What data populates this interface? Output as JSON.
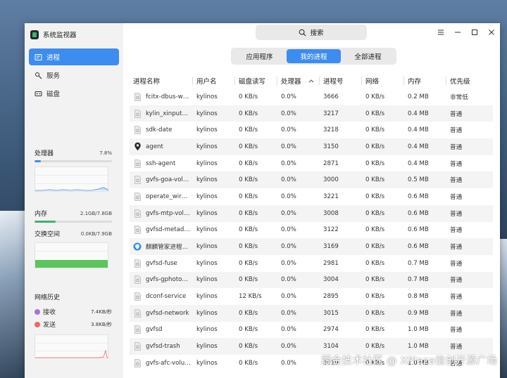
{
  "app": {
    "title": "系统监视器"
  },
  "sidebar": {
    "items": [
      {
        "label": "进程",
        "icon": "process-icon",
        "active": true
      },
      {
        "label": "服务",
        "icon": "service-icon",
        "active": false
      },
      {
        "label": "磁盘",
        "icon": "disk-icon",
        "active": false
      }
    ],
    "cpu": {
      "label": "处理器",
      "value": "7.8%",
      "percent": 7.8
    },
    "memory": {
      "label": "内存",
      "value": "2.1GB/7.8GB",
      "percent": 27
    },
    "swap": {
      "label": "交换空间",
      "value": "0.0KB/7.9GB",
      "percent": 0
    },
    "network": {
      "label": "网络历史",
      "recv_label": "接收",
      "recv_value": "7.4KB/秒",
      "recv_color": "#a675d8",
      "send_label": "发送",
      "send_value": "3.8KB/秒",
      "send_color": "#e86a6a"
    }
  },
  "search": {
    "label": "搜索"
  },
  "window_controls": {
    "menu": "☰",
    "minimize": "—",
    "maximize": "▢",
    "close": "✕"
  },
  "tabs": [
    {
      "label": "应用程序",
      "active": false
    },
    {
      "label": "我的进程",
      "active": true
    },
    {
      "label": "全部进程",
      "active": false
    }
  ],
  "columns": [
    "进程名称",
    "用户名",
    "磁盘读写",
    "处理器",
    "进程号",
    "网络",
    "内存",
    "优先级"
  ],
  "rows": [
    {
      "name": "fcitx-dbus-w…",
      "user": "kylinos",
      "disk": "0 KB/s",
      "cpu": "0.0%",
      "pid": "3666",
      "net": "0 KB/s",
      "mem": "0.2 MB",
      "prio": "非常低",
      "icon": "generic"
    },
    {
      "name": "kylin_xinput…",
      "user": "kylinos",
      "disk": "0 KB/s",
      "cpu": "0.0%",
      "pid": "3217",
      "net": "0 KB/s",
      "mem": "0.4 MB",
      "prio": "普通",
      "icon": "generic"
    },
    {
      "name": "sdk-date",
      "user": "kylinos",
      "disk": "0 KB/s",
      "cpu": "0.0%",
      "pid": "3218",
      "net": "0 KB/s",
      "mem": "0.4 MB",
      "prio": "普通",
      "icon": "generic"
    },
    {
      "name": "agent",
      "user": "kylinos",
      "disk": "0 KB/s",
      "cpu": "0.0%",
      "pid": "3150",
      "net": "0 KB/s",
      "mem": "0.4 MB",
      "prio": "普通",
      "icon": "pin"
    },
    {
      "name": "ssh-agent",
      "user": "kylinos",
      "disk": "0 KB/s",
      "cpu": "0.0%",
      "pid": "2871",
      "net": "0 KB/s",
      "mem": "0.4 MB",
      "prio": "普通",
      "icon": "generic"
    },
    {
      "name": "gvfs-goa-vol…",
      "user": "kylinos",
      "disk": "0 KB/s",
      "cpu": "0.0%",
      "pid": "3000",
      "net": "0 KB/s",
      "mem": "0.5 MB",
      "prio": "普通",
      "icon": "generic"
    },
    {
      "name": "operate_wir…",
      "user": "kylinos",
      "disk": "0 KB/s",
      "cpu": "0.0%",
      "pid": "3221",
      "net": "0 KB/s",
      "mem": "0.6 MB",
      "prio": "普通",
      "icon": "generic"
    },
    {
      "name": "gvfs-mtp-vol…",
      "user": "kylinos",
      "disk": "0 KB/s",
      "cpu": "0.0%",
      "pid": "3008",
      "net": "0 KB/s",
      "mem": "0.6 MB",
      "prio": "普通",
      "icon": "generic"
    },
    {
      "name": "gvfsd-metad…",
      "user": "kylinos",
      "disk": "0 KB/s",
      "cpu": "0.0%",
      "pid": "3122",
      "net": "0 KB/s",
      "mem": "0.6 MB",
      "prio": "普通",
      "icon": "generic"
    },
    {
      "name": "麒麟管家进程…",
      "user": "kylinos",
      "disk": "0 KB/s",
      "cpu": "0.0%",
      "pid": "3169",
      "net": "0 KB/s",
      "mem": "0.6 MB",
      "prio": "普通",
      "icon": "shield"
    },
    {
      "name": "gvfsd-fuse",
      "user": "kylinos",
      "disk": "0 KB/s",
      "cpu": "0.0%",
      "pid": "2981",
      "net": "0 KB/s",
      "mem": "0.7 MB",
      "prio": "普通",
      "icon": "generic"
    },
    {
      "name": "gvfs-gphoto…",
      "user": "kylinos",
      "disk": "0 KB/s",
      "cpu": "0.0%",
      "pid": "3004",
      "net": "0 KB/s",
      "mem": "0.7 MB",
      "prio": "普通",
      "icon": "generic"
    },
    {
      "name": "dconf-service",
      "user": "kylinos",
      "disk": "12 KB/s",
      "cpu": "0.0%",
      "pid": "2895",
      "net": "0 KB/s",
      "mem": "0.8 MB",
      "prio": "普通",
      "icon": "generic"
    },
    {
      "name": "gvfsd-network",
      "user": "kylinos",
      "disk": "0 KB/s",
      "cpu": "0.0%",
      "pid": "3015",
      "net": "0 KB/s",
      "mem": "0.9 MB",
      "prio": "普通",
      "icon": "generic"
    },
    {
      "name": "gvfsd",
      "user": "kylinos",
      "disk": "0 KB/s",
      "cpu": "0.0%",
      "pid": "2974",
      "net": "0 KB/s",
      "mem": "1.0 MB",
      "prio": "普通",
      "icon": "generic"
    },
    {
      "name": "gvfsd-trash",
      "user": "kylinos",
      "disk": "0 KB/s",
      "cpu": "0.0%",
      "pid": "3104",
      "net": "0 KB/s",
      "mem": "1.0 MB",
      "prio": "普通",
      "icon": "generic"
    },
    {
      "name": "gvfs-afc-volu…",
      "user": "kylinos",
      "disk": "0 KB/s",
      "cpu": "0.0%",
      "pid": "3019",
      "net": "0 KB/s",
      "mem": "1.0 MB",
      "prio": "普通",
      "icon": "generic"
    }
  ],
  "watermark": "掘金技术社区 @ XPlaza信创开源广场",
  "colors": {
    "accent": "#3d8cf0",
    "cpu_bar": "#3d8cf0",
    "mem_bar": "#3cb371",
    "swap_fill": "#5cc55c"
  }
}
